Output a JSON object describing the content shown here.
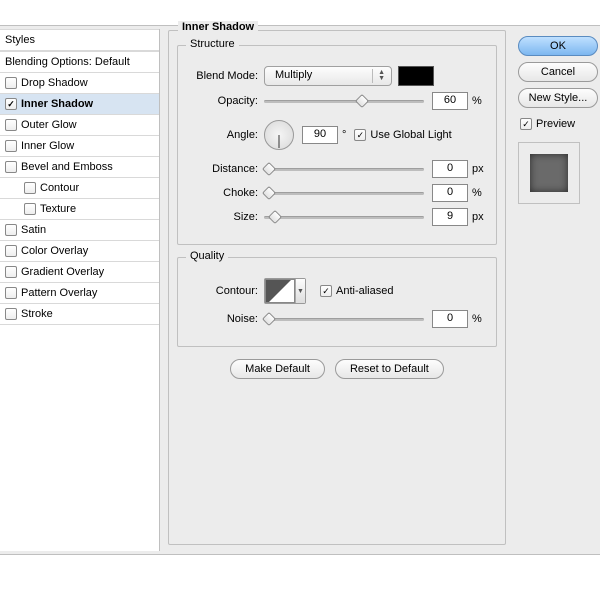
{
  "sidebar": {
    "header": "Styles",
    "blending_options": "Blending Options: Default",
    "items": [
      {
        "label": "Drop Shadow",
        "checked": false,
        "selected": false
      },
      {
        "label": "Inner Shadow",
        "checked": true,
        "selected": true
      },
      {
        "label": "Outer Glow",
        "checked": false,
        "selected": false
      },
      {
        "label": "Inner Glow",
        "checked": false,
        "selected": false
      },
      {
        "label": "Bevel and Emboss",
        "checked": false,
        "selected": false
      },
      {
        "label": "Contour",
        "checked": false,
        "selected": false,
        "indent": true
      },
      {
        "label": "Texture",
        "checked": false,
        "selected": false,
        "indent": true
      },
      {
        "label": "Satin",
        "checked": false,
        "selected": false
      },
      {
        "label": "Color Overlay",
        "checked": false,
        "selected": false
      },
      {
        "label": "Gradient Overlay",
        "checked": false,
        "selected": false
      },
      {
        "label": "Pattern Overlay",
        "checked": false,
        "selected": false
      },
      {
        "label": "Stroke",
        "checked": false,
        "selected": false
      }
    ]
  },
  "panel": {
    "title": "Inner Shadow",
    "structure": {
      "title": "Structure",
      "blend_mode_label": "Blend Mode:",
      "blend_mode_value": "Multiply",
      "opacity_label": "Opacity:",
      "opacity_value": "60",
      "opacity_unit": "%",
      "angle_label": "Angle:",
      "angle_value": "90",
      "angle_unit": "°",
      "global_light_label": "Use Global Light",
      "distance_label": "Distance:",
      "distance_value": "0",
      "distance_unit": "px",
      "choke_label": "Choke:",
      "choke_value": "0",
      "choke_unit": "%",
      "size_label": "Size:",
      "size_value": "9",
      "size_unit": "px"
    },
    "quality": {
      "title": "Quality",
      "contour_label": "Contour:",
      "antialias_label": "Anti-aliased",
      "noise_label": "Noise:",
      "noise_value": "0",
      "noise_unit": "%"
    },
    "make_default": "Make Default",
    "reset_default": "Reset to Default"
  },
  "right": {
    "ok": "OK",
    "cancel": "Cancel",
    "new_style": "New Style...",
    "preview": "Preview"
  }
}
